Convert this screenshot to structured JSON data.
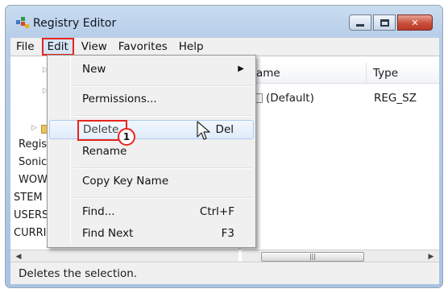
{
  "window": {
    "title": "Registry Editor"
  },
  "menu": [
    "File",
    "Edit",
    "View",
    "Favorites",
    "Help"
  ],
  "tree": {
    "items": [
      "Regis",
      "Sonic",
      "WOW",
      "STEM",
      "USERS",
      "CURRI"
    ]
  },
  "list": {
    "columns": [
      "ame",
      "Type"
    ],
    "rows": [
      {
        "name": "(Default)",
        "type": "REG_SZ"
      }
    ]
  },
  "edit_menu": {
    "items": [
      {
        "label": "New",
        "shortcut": "",
        "submenu": true
      },
      {
        "label": "Permissions...",
        "shortcut": ""
      },
      {
        "label": "Delete",
        "shortcut": "Del",
        "highlighted": true
      },
      {
        "label": "Rename",
        "shortcut": ""
      },
      {
        "label": "Copy Key Name",
        "shortcut": ""
      },
      {
        "label": "Find...",
        "shortcut": "Ctrl+F"
      },
      {
        "label": "Find Next",
        "shortcut": "F3"
      }
    ],
    "callout_number": "1"
  },
  "status": {
    "text": "Deletes the selection."
  },
  "colors": {
    "highlight_box": "#e8241d",
    "menu_active_bg": "#d6e5f6",
    "title_gradient": "#b7cde8"
  }
}
